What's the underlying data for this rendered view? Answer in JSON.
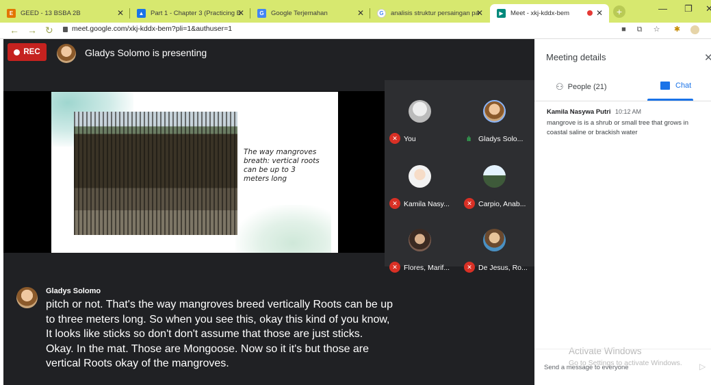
{
  "browser": {
    "tabs": [
      {
        "label": "GEED - 13 BSBA 2B",
        "icon": "classroom-icon",
        "color": "#e37400"
      },
      {
        "label": "Part 1 - Chapter 3 (Practicing E",
        "icon": "drive-icon",
        "color": "#1a73e8"
      },
      {
        "label": "Google Terjemahan",
        "icon": "translate-icon",
        "color": "#4285f4"
      },
      {
        "label": "analisis struktur persaingan pa",
        "icon": "google-icon",
        "color": "#ffffff"
      },
      {
        "label": "Meet - xkj-kddx-bem",
        "icon": "meet-icon",
        "color": "#00897b"
      }
    ],
    "url": "meet.google.com/xkj-kddx-bem?pli=1&authuser=1"
  },
  "meet": {
    "rec_label": "REC",
    "presenter_label": "Gladys Solomo is presenting",
    "slide": {
      "text_lines": [
        "The way mangroves",
        "breath: vertical roots",
        "can be up to 3",
        "meters long"
      ]
    },
    "tiles": [
      {
        "name": "You",
        "muted": true
      },
      {
        "name": "Gladys Solo...",
        "muted": false
      },
      {
        "name": "Kamila Nasy...",
        "muted": true
      },
      {
        "name": "Carpio, Anab...",
        "muted": true
      },
      {
        "name": "Flores, Marif...",
        "muted": true
      },
      {
        "name": "De Jesus, Ro...",
        "muted": true
      }
    ],
    "caption": {
      "speaker": "Gladys Solomo",
      "lines": [
        "pitch or not. That's the way mangroves breed vertically Roots can be up",
        "to three meters long. So when you see this, okay this kind of you know,",
        "It looks like sticks so don't don't assume that those are just sticks.",
        "Okay. In the mat. Those are Mongoose. Now so it it's but those are",
        "vertical Roots okay of the mangroves."
      ]
    }
  },
  "panel": {
    "title": "Meeting details",
    "people_tab": "People (21)",
    "chat_tab": "Chat",
    "message": {
      "sender": "Kamila Nasywa Putri",
      "time": "10:12 AM",
      "text": "mangrove is is a shrub or small tree that grows in coastal saline or brackish water"
    },
    "input_placeholder": "Send a message to everyone"
  },
  "watermark": {
    "line1": "Activate Windows",
    "line2": "Go to Settings to activate Windows."
  }
}
